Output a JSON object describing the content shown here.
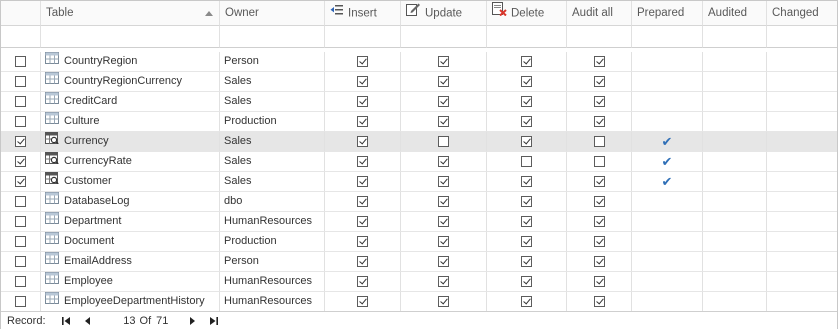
{
  "columns": [
    {
      "label": ""
    },
    {
      "label": "Table"
    },
    {
      "label": "Owner"
    },
    {
      "label": "Insert",
      "icon": "insert-icon"
    },
    {
      "label": "Update",
      "icon": "update-icon"
    },
    {
      "label": "Delete",
      "icon": "delete-icon"
    },
    {
      "label": "Audit all"
    },
    {
      "label": "Prepared"
    },
    {
      "label": "Audited"
    },
    {
      "label": "Changed"
    }
  ],
  "rows": [
    {
      "selected": false,
      "table": "CountryRegion",
      "owner": "Person",
      "insert": true,
      "update": true,
      "delete": true,
      "audit_all": true,
      "prepared": false,
      "audited": false,
      "changed": false,
      "icon": "table-icon"
    },
    {
      "selected": false,
      "table": "CountryRegionCurrency",
      "owner": "Sales",
      "insert": true,
      "update": true,
      "delete": true,
      "audit_all": true,
      "prepared": false,
      "audited": false,
      "changed": false,
      "icon": "table-icon"
    },
    {
      "selected": false,
      "table": "CreditCard",
      "owner": "Sales",
      "insert": true,
      "update": true,
      "delete": true,
      "audit_all": true,
      "prepared": false,
      "audited": false,
      "changed": false,
      "icon": "table-icon"
    },
    {
      "selected": false,
      "table": "Culture",
      "owner": "Production",
      "insert": true,
      "update": true,
      "delete": true,
      "audit_all": true,
      "prepared": false,
      "audited": false,
      "changed": false,
      "icon": "table-icon"
    },
    {
      "selected": true,
      "highlight": true,
      "table": "Currency",
      "owner": "Sales",
      "insert": true,
      "update": false,
      "delete": true,
      "audit_all": false,
      "prepared": true,
      "audited": false,
      "changed": false,
      "icon": "table-audit-icon"
    },
    {
      "selected": true,
      "table": "CurrencyRate",
      "owner": "Sales",
      "insert": true,
      "update": true,
      "delete": false,
      "audit_all": false,
      "prepared": true,
      "audited": false,
      "changed": false,
      "icon": "table-audit-icon"
    },
    {
      "selected": true,
      "table": "Customer",
      "owner": "Sales",
      "insert": true,
      "update": true,
      "delete": true,
      "audit_all": true,
      "prepared": true,
      "audited": false,
      "changed": false,
      "icon": "table-audit-icon"
    },
    {
      "selected": false,
      "table": "DatabaseLog",
      "owner": "dbo",
      "insert": true,
      "update": true,
      "delete": true,
      "audit_all": true,
      "prepared": false,
      "audited": false,
      "changed": false,
      "icon": "table-icon"
    },
    {
      "selected": false,
      "table": "Department",
      "owner": "HumanResources",
      "insert": true,
      "update": true,
      "delete": true,
      "audit_all": true,
      "prepared": false,
      "audited": false,
      "changed": false,
      "icon": "table-icon"
    },
    {
      "selected": false,
      "table": "Document",
      "owner": "Production",
      "insert": true,
      "update": true,
      "delete": true,
      "audit_all": true,
      "prepared": false,
      "audited": false,
      "changed": false,
      "icon": "table-icon"
    },
    {
      "selected": false,
      "table": "EmailAddress",
      "owner": "Person",
      "insert": true,
      "update": true,
      "delete": true,
      "audit_all": true,
      "prepared": false,
      "audited": false,
      "changed": false,
      "icon": "table-icon"
    },
    {
      "selected": false,
      "table": "Employee",
      "owner": "HumanResources",
      "insert": true,
      "update": true,
      "delete": true,
      "audit_all": true,
      "prepared": false,
      "audited": false,
      "changed": false,
      "icon": "table-icon"
    },
    {
      "selected": false,
      "table": "EmployeeDepartmentHistory",
      "owner": "HumanResources",
      "insert": true,
      "update": true,
      "delete": true,
      "audit_all": true,
      "prepared": false,
      "audited": false,
      "changed": false,
      "icon": "table-icon"
    }
  ],
  "footer": {
    "label": "Record:",
    "current": "13",
    "of": "Of",
    "total": "71",
    "nav": [
      "first-record-icon",
      "previous-record-icon",
      "next-record-icon",
      "last-record-icon"
    ]
  },
  "colors": {
    "prepared_tick": "#2f6fb7",
    "selected_row": "#e6e6e6",
    "delete_icon_accent": "#d9362b",
    "insert_icon_accent": "#2b62b5"
  }
}
